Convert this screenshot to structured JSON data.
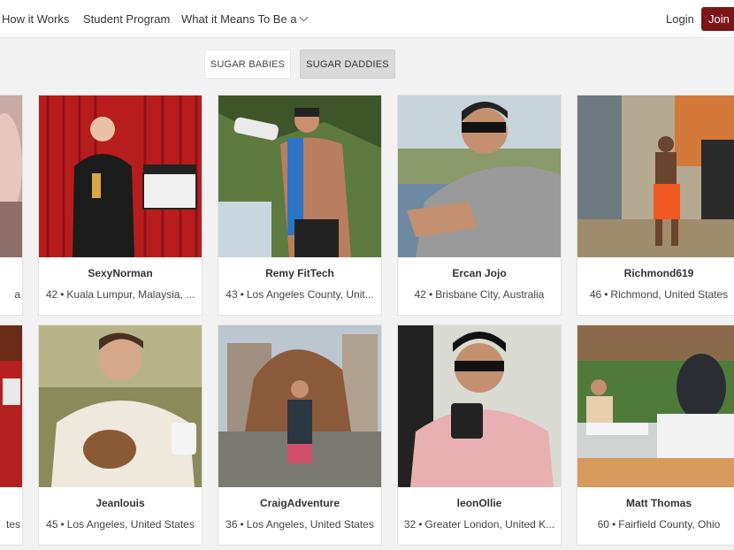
{
  "nav": {
    "how_it_works": "How it Works",
    "student_program": "Student Program",
    "what_it_means": "What it Means To Be a",
    "login": "Login",
    "join": "Join"
  },
  "toggle": {
    "babies": "SUGAR BABIES",
    "daddies": "SUGAR DADDIES"
  },
  "profiles": [
    {
      "name": "",
      "age": "",
      "location": "a"
    },
    {
      "name": "SexyNorman",
      "age": "42",
      "location": "Kuala Lumpur, Malaysia, ..."
    },
    {
      "name": "Remy FitTech",
      "age": "43",
      "location": "Los Angeles County, Unit..."
    },
    {
      "name": "Ercan Jojo",
      "age": "42",
      "location": "Brisbane City, Australia"
    },
    {
      "name": "Richmond619",
      "age": "46",
      "location": "Richmond, United States"
    },
    {
      "name": "",
      "age": "",
      "location": "tes"
    },
    {
      "name": "Jeanlouis",
      "age": "45",
      "location": "Los Angeles, United States"
    },
    {
      "name": "CraigAdventure",
      "age": "36",
      "location": "Los Angeles, United States"
    },
    {
      "name": "leonOllie",
      "age": "32",
      "location": "Greater London, United K..."
    },
    {
      "name": "Matt Thomas",
      "age": "60",
      "location": "Fairfield County, Ohio"
    }
  ],
  "colors": {
    "brand": "#7b1517",
    "background": "#f2f2f2",
    "card": "#ffffff"
  },
  "icons": {
    "chevron": "chevron-down-icon"
  }
}
